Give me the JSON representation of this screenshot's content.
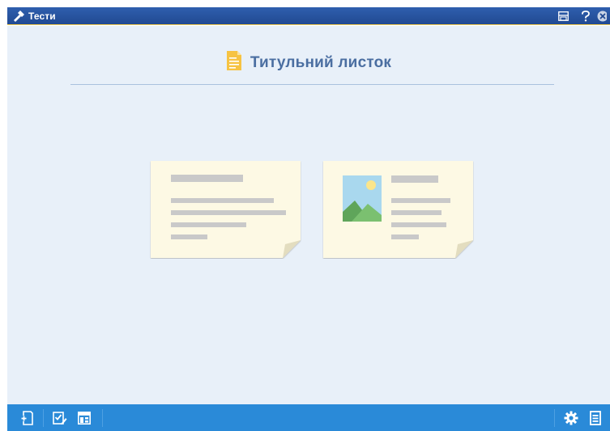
{
  "window": {
    "title": "Тести",
    "icons": [
      "hammer-icon",
      "save-icon",
      "help-icon",
      "close-icon"
    ]
  },
  "main": {
    "heading": "Титульний листок",
    "heading_icon": "document-icon",
    "layout_options": [
      {
        "name": "text-only-layout"
      },
      {
        "name": "image-and-text-layout"
      }
    ]
  },
  "toolbar": {
    "left_icons": [
      "add-page-icon",
      "edit-checklist-icon",
      "layout-icon"
    ],
    "right_icons": [
      "settings-icon",
      "menu-icon"
    ]
  },
  "colors": {
    "titlebar": "#214a92",
    "background": "#e8f0f9",
    "heading": "#4a6ea1",
    "toolbar": "#2a8ad8",
    "card": "#fdf9e4",
    "placeholder_line": "#c9c9c9"
  }
}
